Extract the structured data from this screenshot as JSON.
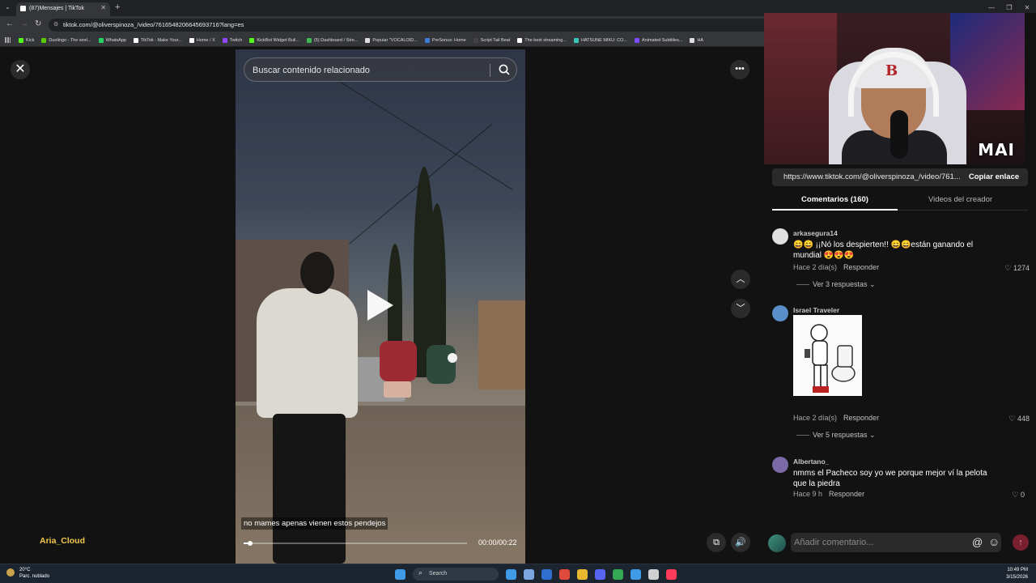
{
  "browser": {
    "tab_title": "(87)Mensajes | TikTok",
    "new_tab_symbol": "+",
    "url": "tiktok.com/@oliverspinoza_/video/7616548206645693716?lang=es",
    "bookmarks": [
      {
        "label": "Kick",
        "color": "#53fc18"
      },
      {
        "label": "Duolingo - The worl...",
        "color": "#58cc02"
      },
      {
        "label": "WhatsApp",
        "color": "#25d366"
      },
      {
        "label": "TikTok - Make Your...",
        "color": "#ffffff"
      },
      {
        "label": "Home / X",
        "color": "#ffffff"
      },
      {
        "label": "Twitch",
        "color": "#9146ff"
      },
      {
        "label": "KickBot Widget Buil...",
        "color": "#53fc18"
      },
      {
        "label": "(5) Dashboard / Stre...",
        "color": "#3fb950"
      },
      {
        "label": "Popular \"VOCALOID...",
        "color": "#dddddd"
      },
      {
        "label": "PreSonus: Home",
        "color": "#3a7bd5"
      },
      {
        "label": "Script Tail Beat",
        "color": "#444444"
      },
      {
        "label": "The best streaming...",
        "color": "#ffffff"
      },
      {
        "label": "HATSUNE MIKU: CO...",
        "color": "#39c5bb"
      },
      {
        "label": "Animated Subtitles...",
        "color": "#7c4dff"
      },
      {
        "label": "HA",
        "color": "#dddddd"
      }
    ]
  },
  "video": {
    "search_placeholder": "Buscar contenido relacionado",
    "caption": "no mames apenas vienen estos pendejos",
    "time": "00:00/00:22",
    "progress": 0.03
  },
  "stream_overlay": {
    "label": "MAI"
  },
  "sidebar": {
    "share_url": "https://www.tiktok.com/@oliverspinoza_/video/761...",
    "copy_label": "Copiar enlace",
    "tabs": [
      "Comentarios (160)",
      "Videos del creador"
    ],
    "comments": [
      {
        "user": "arkasegura14",
        "text": "😄😄 ¡¡Nó los despierten!! 😄😄están ganando el mundial 😍😍😍",
        "time": "Hace 2 día(s)",
        "reply": "Responder",
        "likes": "1274",
        "replies": "Ver 3 respuestas",
        "avatar_color": "#e0e0e0"
      },
      {
        "user": "Israel Traveler",
        "text": "",
        "time": "Hace 2 día(s)",
        "reply": "Responder",
        "likes": "448",
        "replies": "Ver 5 respuestas",
        "avatar_color": "#5a8ec9"
      },
      {
        "user": "Albertano_",
        "text": "nmms el Pacheco soy yo we porque mejor ví la pelota que la piedra",
        "time": "Hace 9 h",
        "reply": "Responder",
        "likes": "0",
        "avatar_color": "#7a6aa8"
      }
    ],
    "comment_placeholder": "Añadir comentario...",
    "overlay_name": "Aria_Cloud"
  },
  "taskbar": {
    "temperature": "20°C",
    "weather": "Parc. nublado",
    "search": "Search",
    "time": "10:49 PM",
    "date": "3/15/2026",
    "app_colors": [
      "#3f9be8",
      "#7aa6e0",
      "#2f6fd0",
      "#e04a3a",
      "#e8b830",
      "#5865f2",
      "#34a853",
      "#3f9be8",
      "#d0d0d0",
      "#fa3c5a"
    ]
  }
}
